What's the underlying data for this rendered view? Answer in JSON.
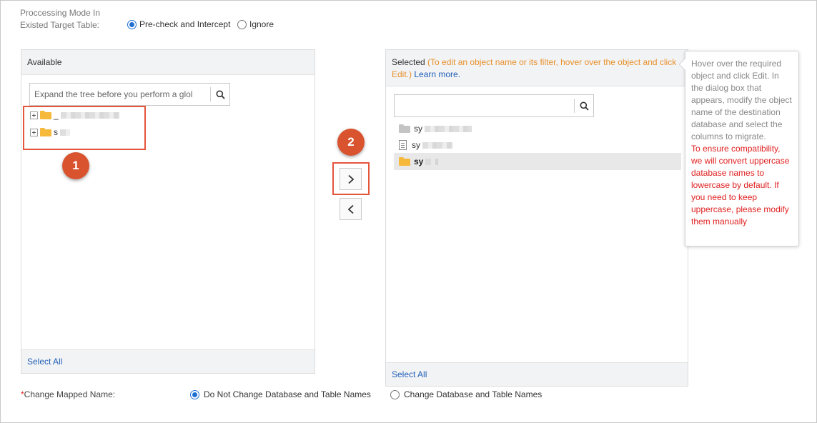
{
  "processing_mode": {
    "label_line1": "Proccessing Mode In",
    "label_line2": "Existed Target Table:",
    "options": [
      "Pre-check and Intercept",
      "Ignore"
    ],
    "selected": "Pre-check and Intercept"
  },
  "available_panel": {
    "title": "Available",
    "search_placeholder": "Expand the tree before you perform a glol",
    "tree_items": [
      {
        "label": "_",
        "icon": "folder-icon"
      },
      {
        "label": "s",
        "icon": "folder-icon"
      }
    ],
    "select_all": "Select All"
  },
  "selected_panel": {
    "title": "Selected",
    "hint": "(To edit an object name or its filter, hover over the object and click Edit.)",
    "learn_more": "Learn more.",
    "search_placeholder": "",
    "items": [
      {
        "label": "sy",
        "icon": "folder-icon"
      },
      {
        "label": "sy",
        "icon": "document-icon"
      },
      {
        "label": "sy",
        "icon": "folder-icon"
      }
    ],
    "select_all": "Select All"
  },
  "callouts": {
    "first": "1",
    "second": "2"
  },
  "tooltip": {
    "info": "Hover over the required object and click Edit. In the dialog box that appears, modify the object name of the destination database and select the columns to migrate.",
    "warning": "To ensure compatibility, we will convert uppercase database names to lowercase by default. If you need to keep uppercase, please modify them manually"
  },
  "mapped_name": {
    "required_mark": "*",
    "label": "Change Mapped Name:",
    "options": [
      "Do Not Change Database and Table Names",
      "Change Database and Table Names"
    ],
    "selected": "Do Not Change Database and Table Names"
  },
  "colors": {
    "accent_blue": "#1f6fd1",
    "link_blue": "#1f5fb8",
    "hint_orange": "#e8902a",
    "callout_red": "#d9532f",
    "warning_red": "#e02020"
  }
}
